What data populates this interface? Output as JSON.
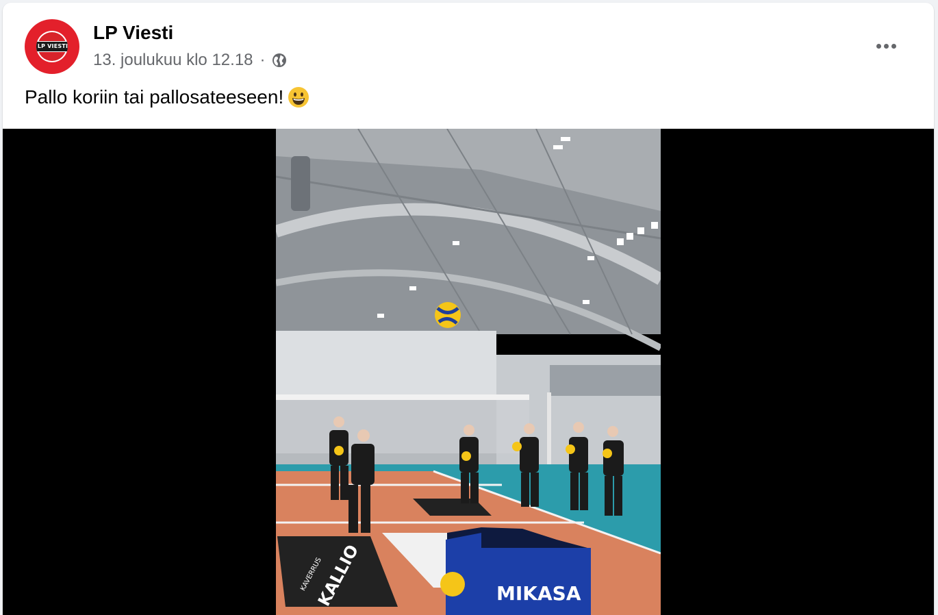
{
  "post": {
    "page_name": "LP Viesti",
    "avatar_text": "LP VIESTI",
    "timestamp": "13. joulukuu klo 12.18",
    "separator": "·",
    "audience_icon": "globe-icon",
    "more_icon": "more-horizontal-icon",
    "text": "Pallo koriin tai pallosateeseen!",
    "emoji": "grinning-face-emoji"
  },
  "video": {
    "court_ads": [
      "KAVERRUS",
      "KALLIO"
    ],
    "basket_brand": "MIKASA",
    "colors": {
      "court": "#d9825e",
      "free_zone": "#2c9cab",
      "ball_yellow": "#f5c518",
      "ball_blue": "#1f3f9a",
      "basket_blue": "#1c3fa8"
    }
  },
  "colors": {
    "brand_red": "#e3202b",
    "text_primary": "#050505",
    "text_secondary": "#65676b"
  }
}
